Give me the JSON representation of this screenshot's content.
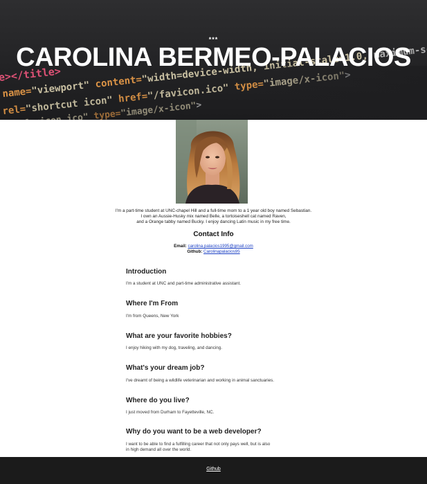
{
  "hero": {
    "dots": "***",
    "title": "CAROLINA BERMEO-PALACIOS"
  },
  "profile": {
    "photo_alt": "Carolina Bermeo-Palacios",
    "bio_lines": [
      "I'm a part-time student at UNC-chapel Hill and a full-time mom to a 1 year old boy named Sebastian.",
      "I own an Aussie-Husky mix named Belle, a tortoiseshell cat named Raven,",
      "and a Orange tabby named Bucky. I enjoy dancing Latin music in my free time."
    ]
  },
  "contact": {
    "heading": "Contact Info",
    "email_label": "Email:",
    "email_value": "carolina.palacios1995@gmail.com",
    "github_label": "Github:",
    "github_value": "Carolinapalacios95"
  },
  "sections": [
    {
      "title": "Introduction",
      "text": "I'm a student at UNC and part-time administrative assistant."
    },
    {
      "title": "Where I'm From",
      "text": "I'm from Queens, New York"
    },
    {
      "title": "What are your favorite hobbies?",
      "text": "I enjoy hiking with my dog, traveling, and dancing."
    },
    {
      "title": "What's your dream job?",
      "text": "I've dreamt of being a wildlife veterinarian and working in animal sanctuaries."
    },
    {
      "title": "Where do you live?",
      "text": "I just moved from Durham to Fayetteville, NC."
    },
    {
      "title": "Why do you want to be a web developer?",
      "text_lines": [
        "I want to be able to find a fulfilling career that not only pays well, but is also",
        "in high demand all over the world."
      ]
    }
  ],
  "footer": {
    "link_label": "Github"
  }
}
